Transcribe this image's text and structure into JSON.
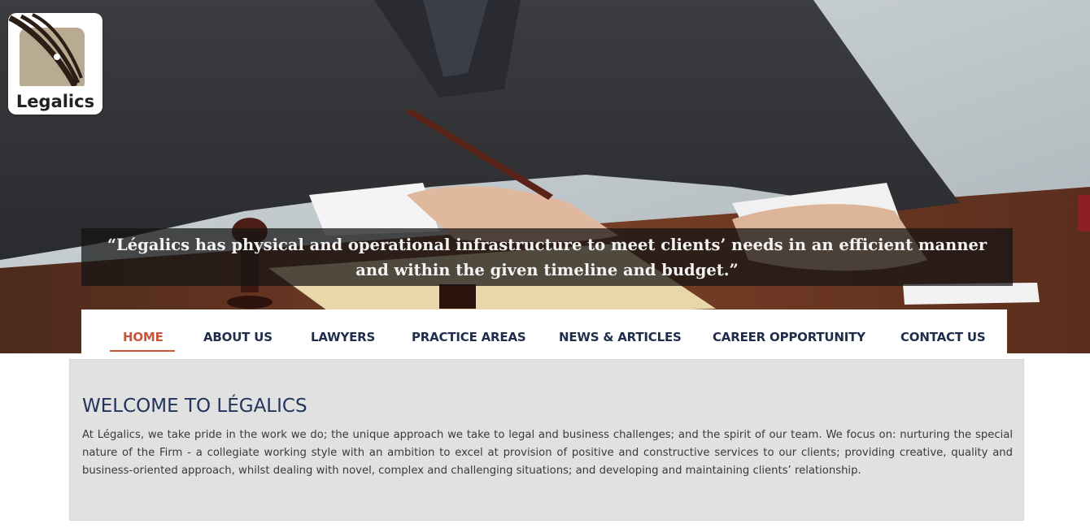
{
  "brand": {
    "logo_text": "Legalics"
  },
  "hero": {
    "quote": "“Légalics has physical and operational infrastructure to meet clients’ needs in an efficient manner and within the given timeline and budget.”"
  },
  "nav": {
    "items": [
      "HOME",
      "ABOUT US",
      "LAWYERS",
      "PRACTICE AREAS",
      "NEWS & ARTICLES",
      "CAREER OPPORTUNITY",
      "CONTACT US"
    ],
    "active": "HOME"
  },
  "welcome": {
    "title": "WELCOME TO LÉGALICS",
    "body": "At Légalics, we take pride in the work we do; the unique approach we take to legal and business challenges; and the spirit of our team. We focus on: nurturing the special nature of the Firm - a collegiate working style with an ambition to excel at provision of positive and constructive services to our clients; providing creative, quality and business-oriented approach, whilst dealing with novel, complex and challenging situations; and developing and maintaining clients’ relationship."
  },
  "colors": {
    "accent": "#c9553b",
    "nav_text": "#1f2d4d",
    "title": "#22345b"
  }
}
